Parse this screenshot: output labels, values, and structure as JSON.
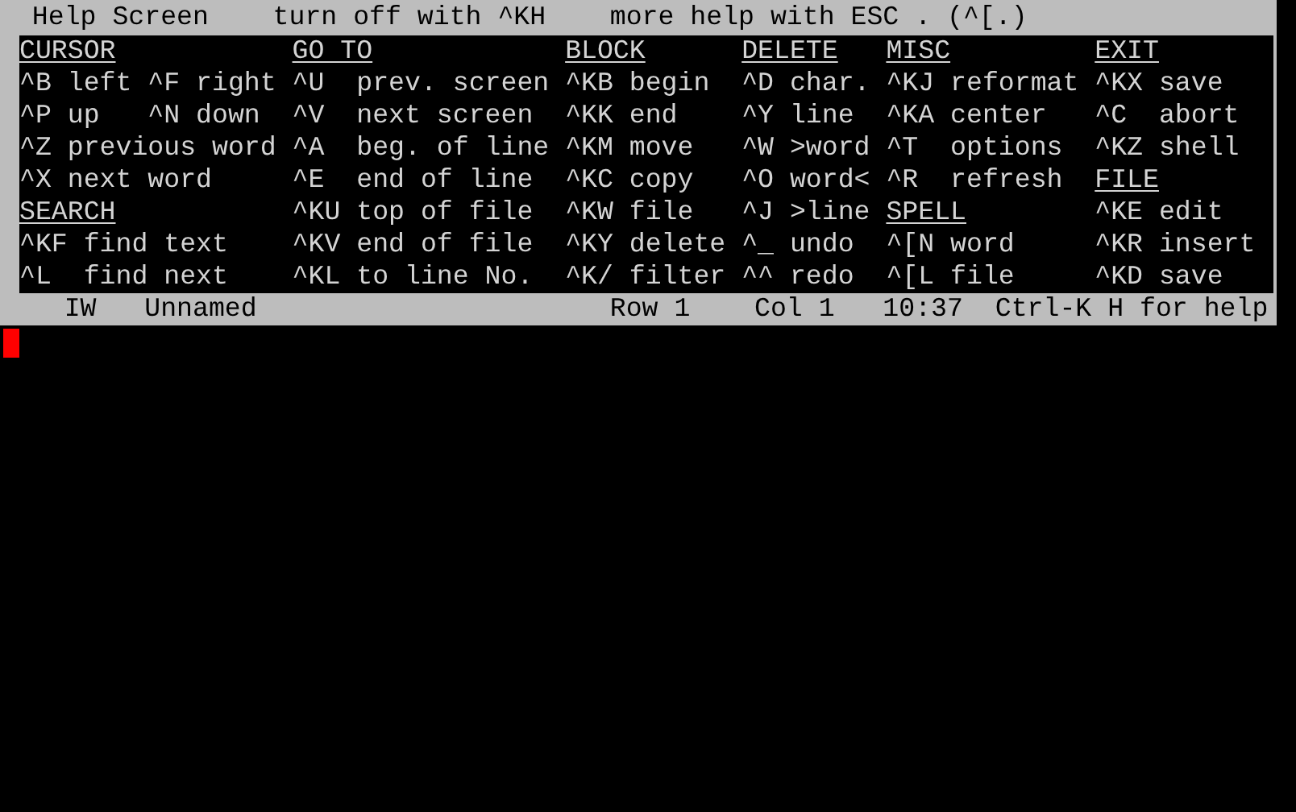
{
  "title_bar": [
    {
      "text": "Help Screen"
    },
    {
      "text": "turn off with ^KH"
    },
    {
      "text": "more help with ESC . (^[.)"
    }
  ],
  "help_rows": [
    [
      {
        "kind": "heading",
        "text": "CURSOR"
      },
      {
        "kind": "heading",
        "text": "GO TO"
      },
      {
        "kind": "heading",
        "text": "BLOCK"
      },
      {
        "kind": "heading",
        "text": "DELETE"
      },
      {
        "kind": "heading",
        "text": "MISC"
      },
      {
        "kind": "heading",
        "text": "EXIT"
      }
    ],
    [
      {
        "kind": "entry",
        "text": "^B left ^F right"
      },
      {
        "kind": "entry",
        "text": "^U  prev. screen"
      },
      {
        "kind": "entry",
        "text": "^KB begin"
      },
      {
        "kind": "entry",
        "text": "^D char."
      },
      {
        "kind": "entry",
        "text": "^KJ reformat"
      },
      {
        "kind": "entry",
        "text": "^KX save"
      }
    ],
    [
      {
        "kind": "entry",
        "text": "^P up   ^N down"
      },
      {
        "kind": "entry",
        "text": "^V  next screen"
      },
      {
        "kind": "entry",
        "text": "^KK end"
      },
      {
        "kind": "entry",
        "text": "^Y line"
      },
      {
        "kind": "entry",
        "text": "^KA center"
      },
      {
        "kind": "entry",
        "text": "^C  abort"
      }
    ],
    [
      {
        "kind": "entry",
        "text": "^Z previous word"
      },
      {
        "kind": "entry",
        "text": "^A  beg. of line"
      },
      {
        "kind": "entry",
        "text": "^KM move"
      },
      {
        "kind": "entry",
        "text": "^W >word"
      },
      {
        "kind": "entry",
        "text": "^T  options"
      },
      {
        "kind": "entry",
        "text": "^KZ shell"
      }
    ],
    [
      {
        "kind": "entry",
        "text": "^X next word"
      },
      {
        "kind": "entry",
        "text": "^E  end of line"
      },
      {
        "kind": "entry",
        "text": "^KC copy"
      },
      {
        "kind": "entry",
        "text": "^O word<"
      },
      {
        "kind": "entry",
        "text": "^R  refresh"
      },
      {
        "kind": "heading",
        "text": "FILE"
      }
    ],
    [
      {
        "kind": "heading",
        "text": "SEARCH"
      },
      {
        "kind": "entry",
        "text": "^KU top of file"
      },
      {
        "kind": "entry",
        "text": "^KW file"
      },
      {
        "kind": "entry",
        "text": "^J >line"
      },
      {
        "kind": "heading",
        "text": "SPELL"
      },
      {
        "kind": "entry",
        "text": "^KE edit"
      }
    ],
    [
      {
        "kind": "entry",
        "text": "^KF find text"
      },
      {
        "kind": "entry",
        "text": "^KV end of file"
      },
      {
        "kind": "entry",
        "text": "^KY delete"
      },
      {
        "kind": "entry",
        "text": "^_ undo"
      },
      {
        "kind": "entry",
        "text": "^[N word"
      },
      {
        "kind": "entry",
        "text": "^KR insert"
      }
    ],
    [
      {
        "kind": "entry",
        "text": "^L  find next"
      },
      {
        "kind": "entry",
        "text": "^KL to line No."
      },
      {
        "kind": "entry",
        "text": "^K/ filter"
      },
      {
        "kind": "entry",
        "text": "^^ redo"
      },
      {
        "kind": "entry",
        "text": "^[L file"
      },
      {
        "kind": "entry",
        "text": "^KD save"
      }
    ]
  ],
  "status_bar": [
    {
      "text": "IW"
    },
    {
      "text": "Unnamed"
    },
    {
      "text": "Row 1"
    },
    {
      "text": "Col 1"
    },
    {
      "text": "10:37"
    },
    {
      "text": "Ctrl-K H for help"
    }
  ]
}
